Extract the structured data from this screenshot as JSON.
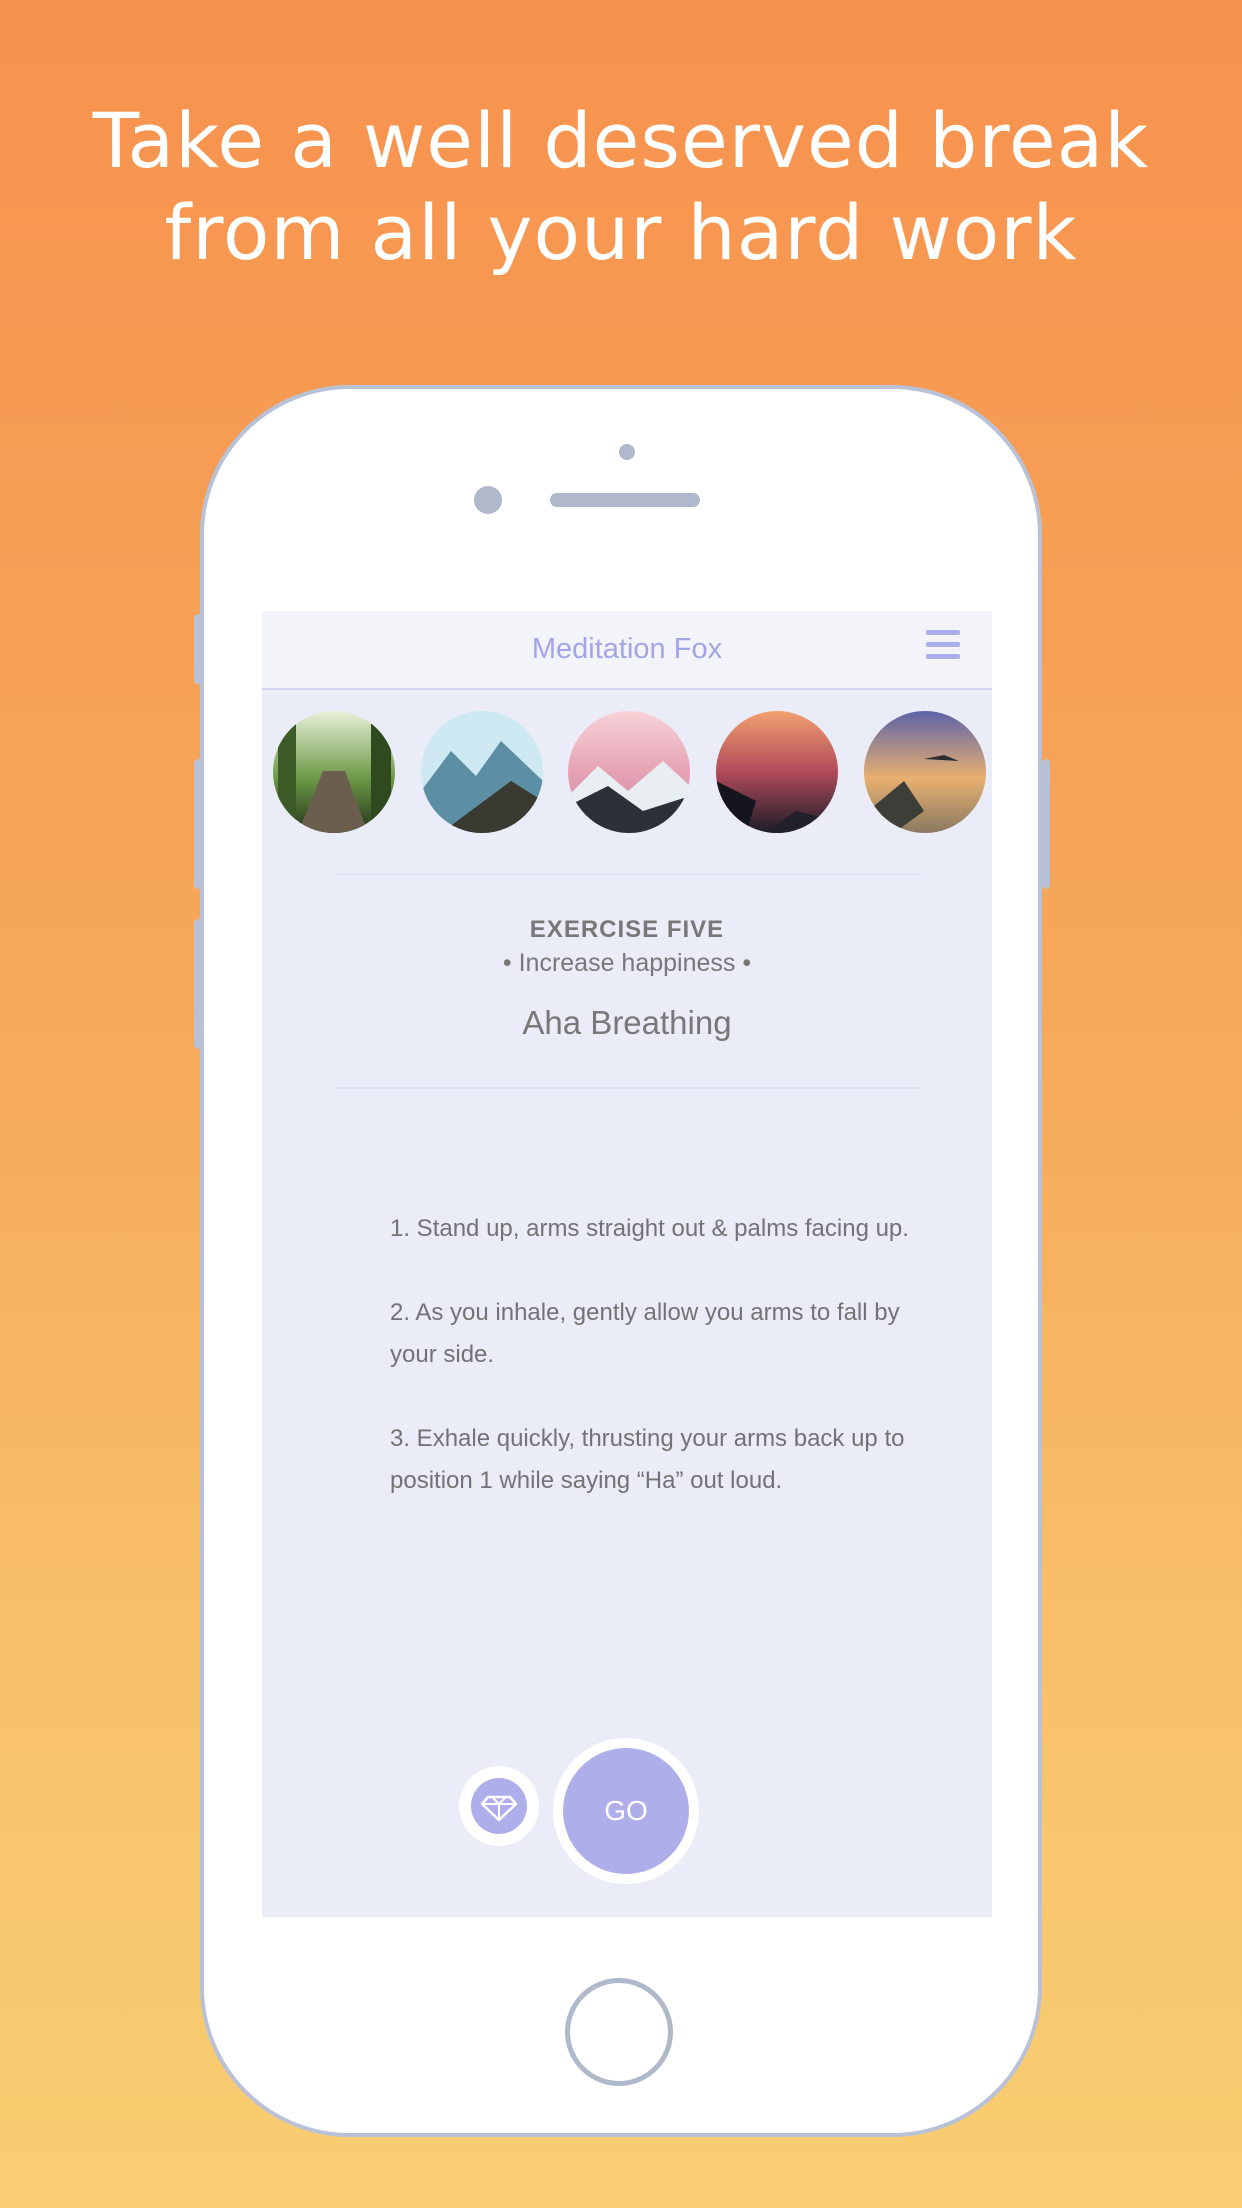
{
  "headline": {
    "line1": "Take a well deserved break",
    "line2": "from all your hard work"
  },
  "nav": {
    "title": "Meditation Fox",
    "menu_icon": "hamburger-menu-icon"
  },
  "thumbnails": [
    {
      "name": "forest-path",
      "colors": [
        "#e8f0d8",
        "#5e8a3c",
        "#24341c"
      ]
    },
    {
      "name": "blue-mountains",
      "colors": [
        "#cfe9f2",
        "#5c8ea4",
        "#3a3a30"
      ]
    },
    {
      "name": "pink-sky-mountains",
      "colors": [
        "#f4c7cf",
        "#c98a9c",
        "#2c3038"
      ]
    },
    {
      "name": "sunset-sea",
      "colors": [
        "#f0a070",
        "#b04a5a",
        "#1c1c28"
      ]
    },
    {
      "name": "dusk-rocks",
      "colors": [
        "#6f72b0",
        "#e8b070",
        "#6a6050"
      ]
    }
  ],
  "exercise": {
    "label": "EXERCISE FIVE",
    "subtitle": "• Increase happiness •",
    "title": "Aha Breathing"
  },
  "steps": [
    "1. Stand up, arms straight out & palms facing up.",
    "2. As you inhale, gently allow you arms to fall by your side.",
    "3. Exhale quickly, thrusting your arms back up to position 1 while saying “Ha” out loud."
  ],
  "actions": {
    "gem_icon": "diamond-icon",
    "go_label": "GO"
  },
  "colors": {
    "accent": "#adaeea",
    "screen_bg": "#eaecf8",
    "text": "#777878"
  }
}
